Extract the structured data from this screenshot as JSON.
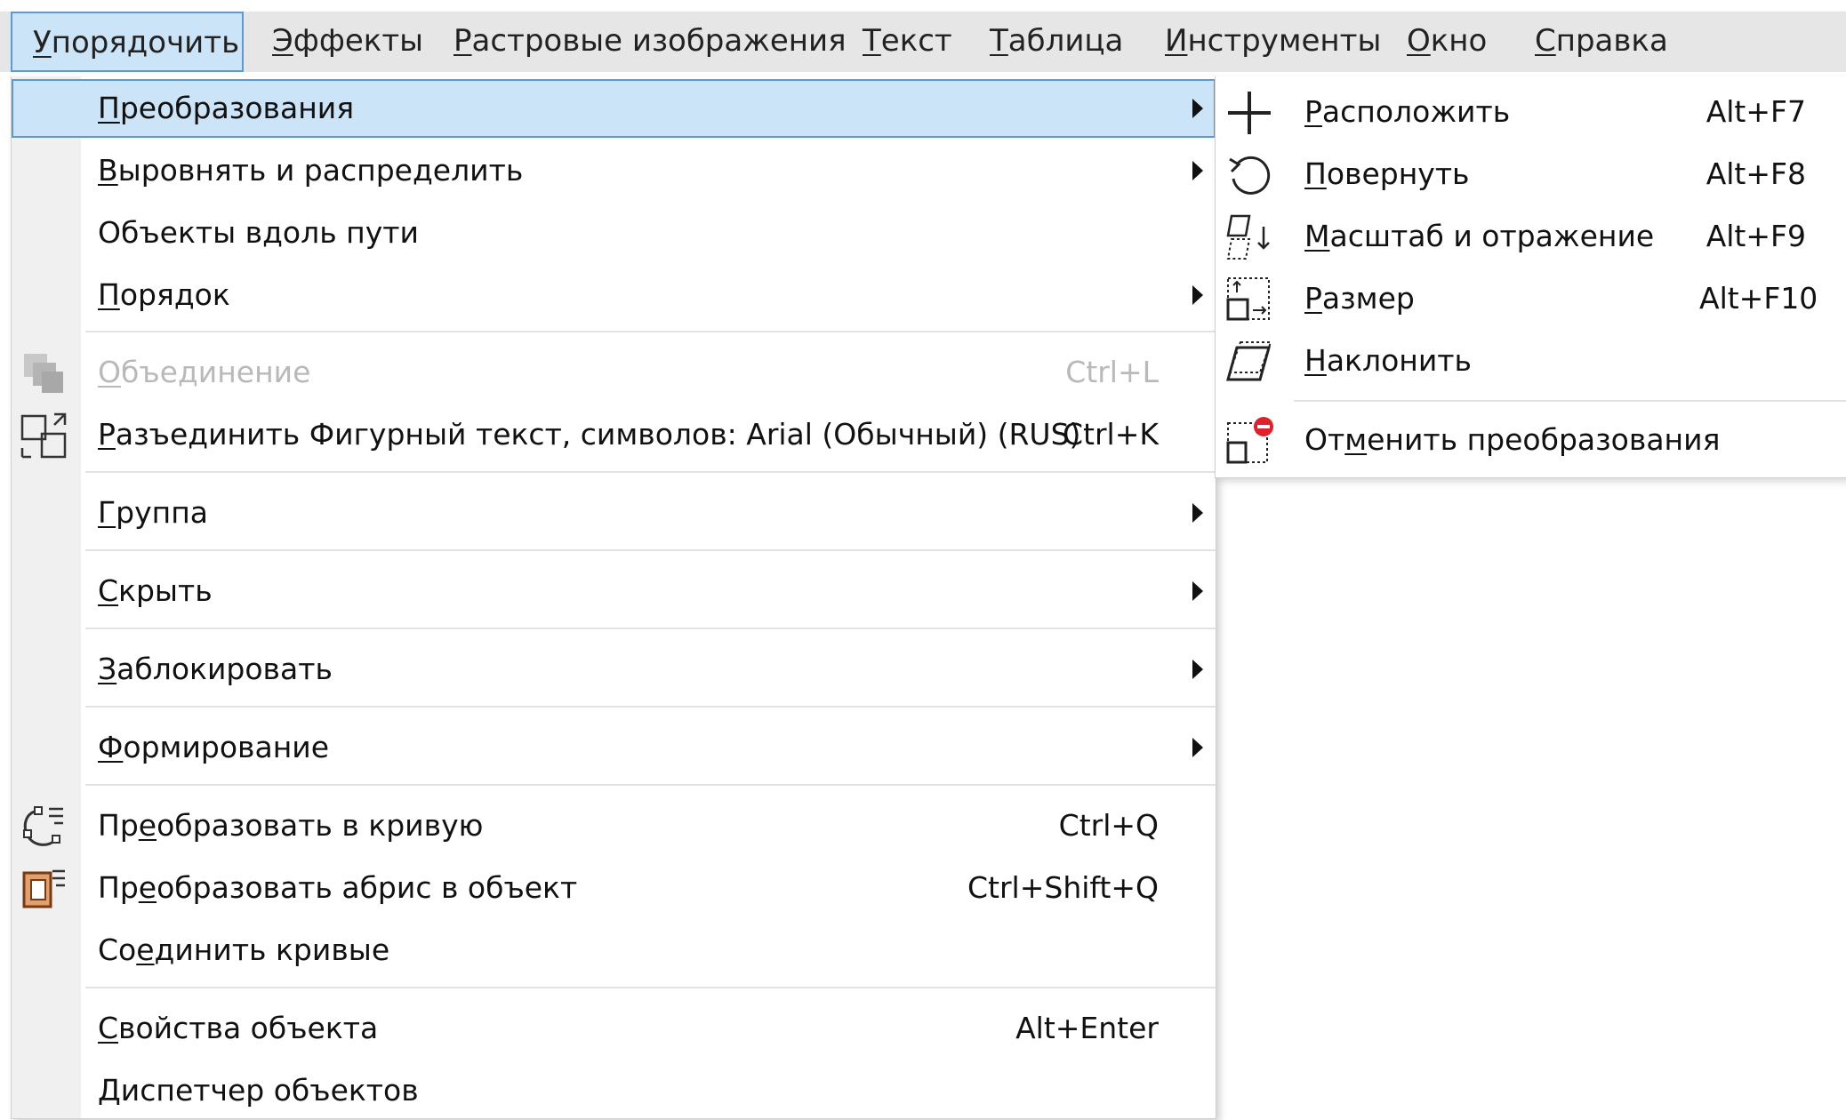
{
  "menubar": [
    {
      "pre": "",
      "key": "У",
      "post": "порядочить",
      "active": true
    },
    {
      "pre": "",
      "key": "Э",
      "post": "ффекты"
    },
    {
      "pre": "",
      "key": "Р",
      "post": "астровые изображения"
    },
    {
      "pre": "",
      "key": "Т",
      "post": "екст"
    },
    {
      "pre": "",
      "key": "Т",
      "post": "аблица"
    },
    {
      "pre": "",
      "key": "И",
      "post": "нструменты"
    },
    {
      "pre": "",
      "key": "О",
      "post": "кно"
    },
    {
      "pre": "",
      "key": "С",
      "post": "правка"
    }
  ],
  "main_menu": [
    {
      "pre": "",
      "key": "П",
      "post": "реобразования",
      "shortcut": "",
      "submenu": true,
      "highlighted": true
    },
    {
      "pre": "",
      "key": "В",
      "post": "ыровнять и распределить",
      "shortcut": "",
      "submenu": true
    },
    {
      "pre": "Объекты вдоль пути",
      "key": "",
      "post": "",
      "shortcut": ""
    },
    {
      "pre": "",
      "key": "П",
      "post": "орядок",
      "shortcut": "",
      "submenu": true
    },
    {
      "pre": "",
      "key": "О",
      "post": "бъединение",
      "shortcut": "Ctrl+L",
      "disabled": true,
      "icon": "combine-icon"
    },
    {
      "pre": "",
      "key": "Р",
      "post": "азъединить Фигурный текст, символов: Arial (Обычный) (RUS)",
      "shortcut": "Ctrl+K",
      "icon": "break-apart-icon"
    },
    {
      "pre": "",
      "key": "Г",
      "post": "руппа",
      "shortcut": "",
      "submenu": true
    },
    {
      "pre": "",
      "key": "С",
      "post": "крыть",
      "shortcut": "",
      "submenu": true
    },
    {
      "pre": "",
      "key": "З",
      "post": "аблокировать",
      "shortcut": "",
      "submenu": true
    },
    {
      "pre": "",
      "key": "Ф",
      "post": "ормирование",
      "shortcut": "",
      "submenu": true
    },
    {
      "pre": "Пр",
      "key": "е",
      "post": "образовать в кривую",
      "shortcut": "Ctrl+Q",
      "icon": "convert-to-curve-icon"
    },
    {
      "pre": "Пр",
      "key": "е",
      "post": "образовать абрис в объект",
      "shortcut": "Ctrl+Shift+Q",
      "icon": "outline-to-object-icon"
    },
    {
      "pre": "Со",
      "key": "е",
      "post": "динить кривые",
      "shortcut": ""
    },
    {
      "pre": "",
      "key": "С",
      "post": "войства объекта",
      "shortcut": "Alt+Enter"
    },
    {
      "pre": "",
      "key": "Д",
      "post": "испетчер объектов",
      "shortcut": ""
    }
  ],
  "sub_menu": [
    {
      "pre": "",
      "key": "Р",
      "post": "асположить",
      "shortcut": "Alt+F7",
      "icon": "position-icon"
    },
    {
      "pre": "",
      "key": "П",
      "post": "овернуть",
      "shortcut": "Alt+F8",
      "icon": "rotate-icon"
    },
    {
      "pre": "",
      "key": "М",
      "post": "асштаб и отражение",
      "shortcut": "Alt+F9",
      "icon": "scale-mirror-icon"
    },
    {
      "pre": "",
      "key": "Р",
      "post": "азмер",
      "shortcut": "Alt+F10",
      "icon": "size-icon"
    },
    {
      "pre": "",
      "key": "Н",
      "post": "аклонить",
      "shortcut": "",
      "icon": "skew-icon"
    },
    {
      "pre": "От",
      "key": "м",
      "post": "енить преобразования",
      "shortcut": "",
      "icon": "clear-transformations-icon"
    }
  ],
  "colors": {
    "highlight": "#cce4f7",
    "highlight_border": "#5a9bd5",
    "menubar_bg": "#e6e6e6",
    "disabled_text": "#b9b9b9"
  }
}
